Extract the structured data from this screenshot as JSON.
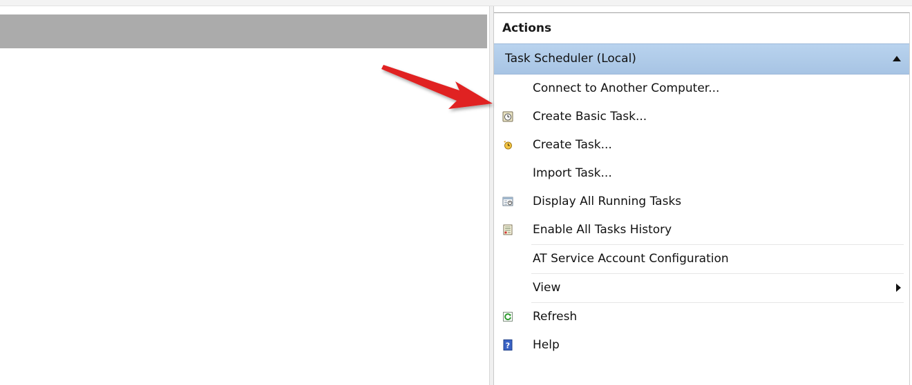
{
  "actions_panel": {
    "title": "Actions",
    "section": {
      "label": "Task Scheduler (Local)"
    },
    "items": [
      {
        "label": "Connect to Another Computer...",
        "icon": "none"
      },
      {
        "label": "Create Basic Task...",
        "icon": "basic-task-icon"
      },
      {
        "label": "Create Task...",
        "icon": "create-task-icon"
      },
      {
        "label": "Import Task...",
        "icon": "none"
      },
      {
        "label": "Display All Running Tasks",
        "icon": "running-tasks-icon"
      },
      {
        "label": "Enable All Tasks History",
        "icon": "tasks-history-icon"
      },
      {
        "label": "AT Service Account Configuration",
        "icon": "none"
      },
      {
        "label": "View",
        "icon": "none",
        "submenu": true
      },
      {
        "label": "Refresh",
        "icon": "refresh-icon"
      },
      {
        "label": "Help",
        "icon": "help-icon"
      }
    ]
  },
  "colors": {
    "section_header": "#b9d3ee",
    "left_header": "#ababab",
    "annotation_arrow": "#e02020"
  }
}
